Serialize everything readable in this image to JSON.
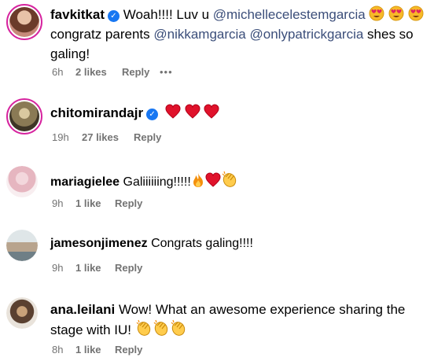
{
  "comments": [
    {
      "username": "favkitkat",
      "verified": true,
      "text_1": "Woah!!!! Luv u ",
      "mention_1": "@michellecelestemgarcia",
      "line_2_prefix": "congratz parents ",
      "mention_2": "@nikkamgarcia",
      "mention_3": "@onlypatrickgarcia",
      "line_2_suffix": " shes so",
      "line_3": "galing!",
      "time": "6h",
      "likes": "2 likes",
      "reply": "Reply",
      "more": "•••",
      "emojis": [
        "heart-eyes-emoji",
        "heart-eyes-emoji",
        "heart-eyes-emoji"
      ]
    },
    {
      "username": "chitomirandajr",
      "verified": true,
      "time": "19h",
      "likes": "27 likes",
      "reply": "Reply",
      "emojis": [
        "red-heart-emoji",
        "red-heart-emoji",
        "red-heart-emoji"
      ]
    },
    {
      "username": "mariagielee",
      "text": "Galiiiiiing!!!!!",
      "time": "9h",
      "likes": "1 like",
      "reply": "Reply",
      "emojis": [
        "fire-emoji",
        "red-heart-emoji",
        "clapping-hands-emoji"
      ]
    },
    {
      "username": "jamesonjimenez",
      "text": "Congrats galing!!!!",
      "time": "9h",
      "likes": "1 like",
      "reply": "Reply"
    },
    {
      "username": "ana.leilani",
      "text_1": "Wow! What an awesome experience sharing the",
      "text_2": "stage with IU! ",
      "time": "8h",
      "likes": "1 like",
      "reply": "Reply",
      "emojis": [
        "clapping-hands-emoji",
        "clapping-hands-emoji",
        "clapping-hands-emoji"
      ]
    }
  ],
  "colors": {
    "mention": "#3b4e7a",
    "meta_text": "#737373",
    "story_ring": "#d6249f",
    "verified_badge": "#1877f2"
  }
}
